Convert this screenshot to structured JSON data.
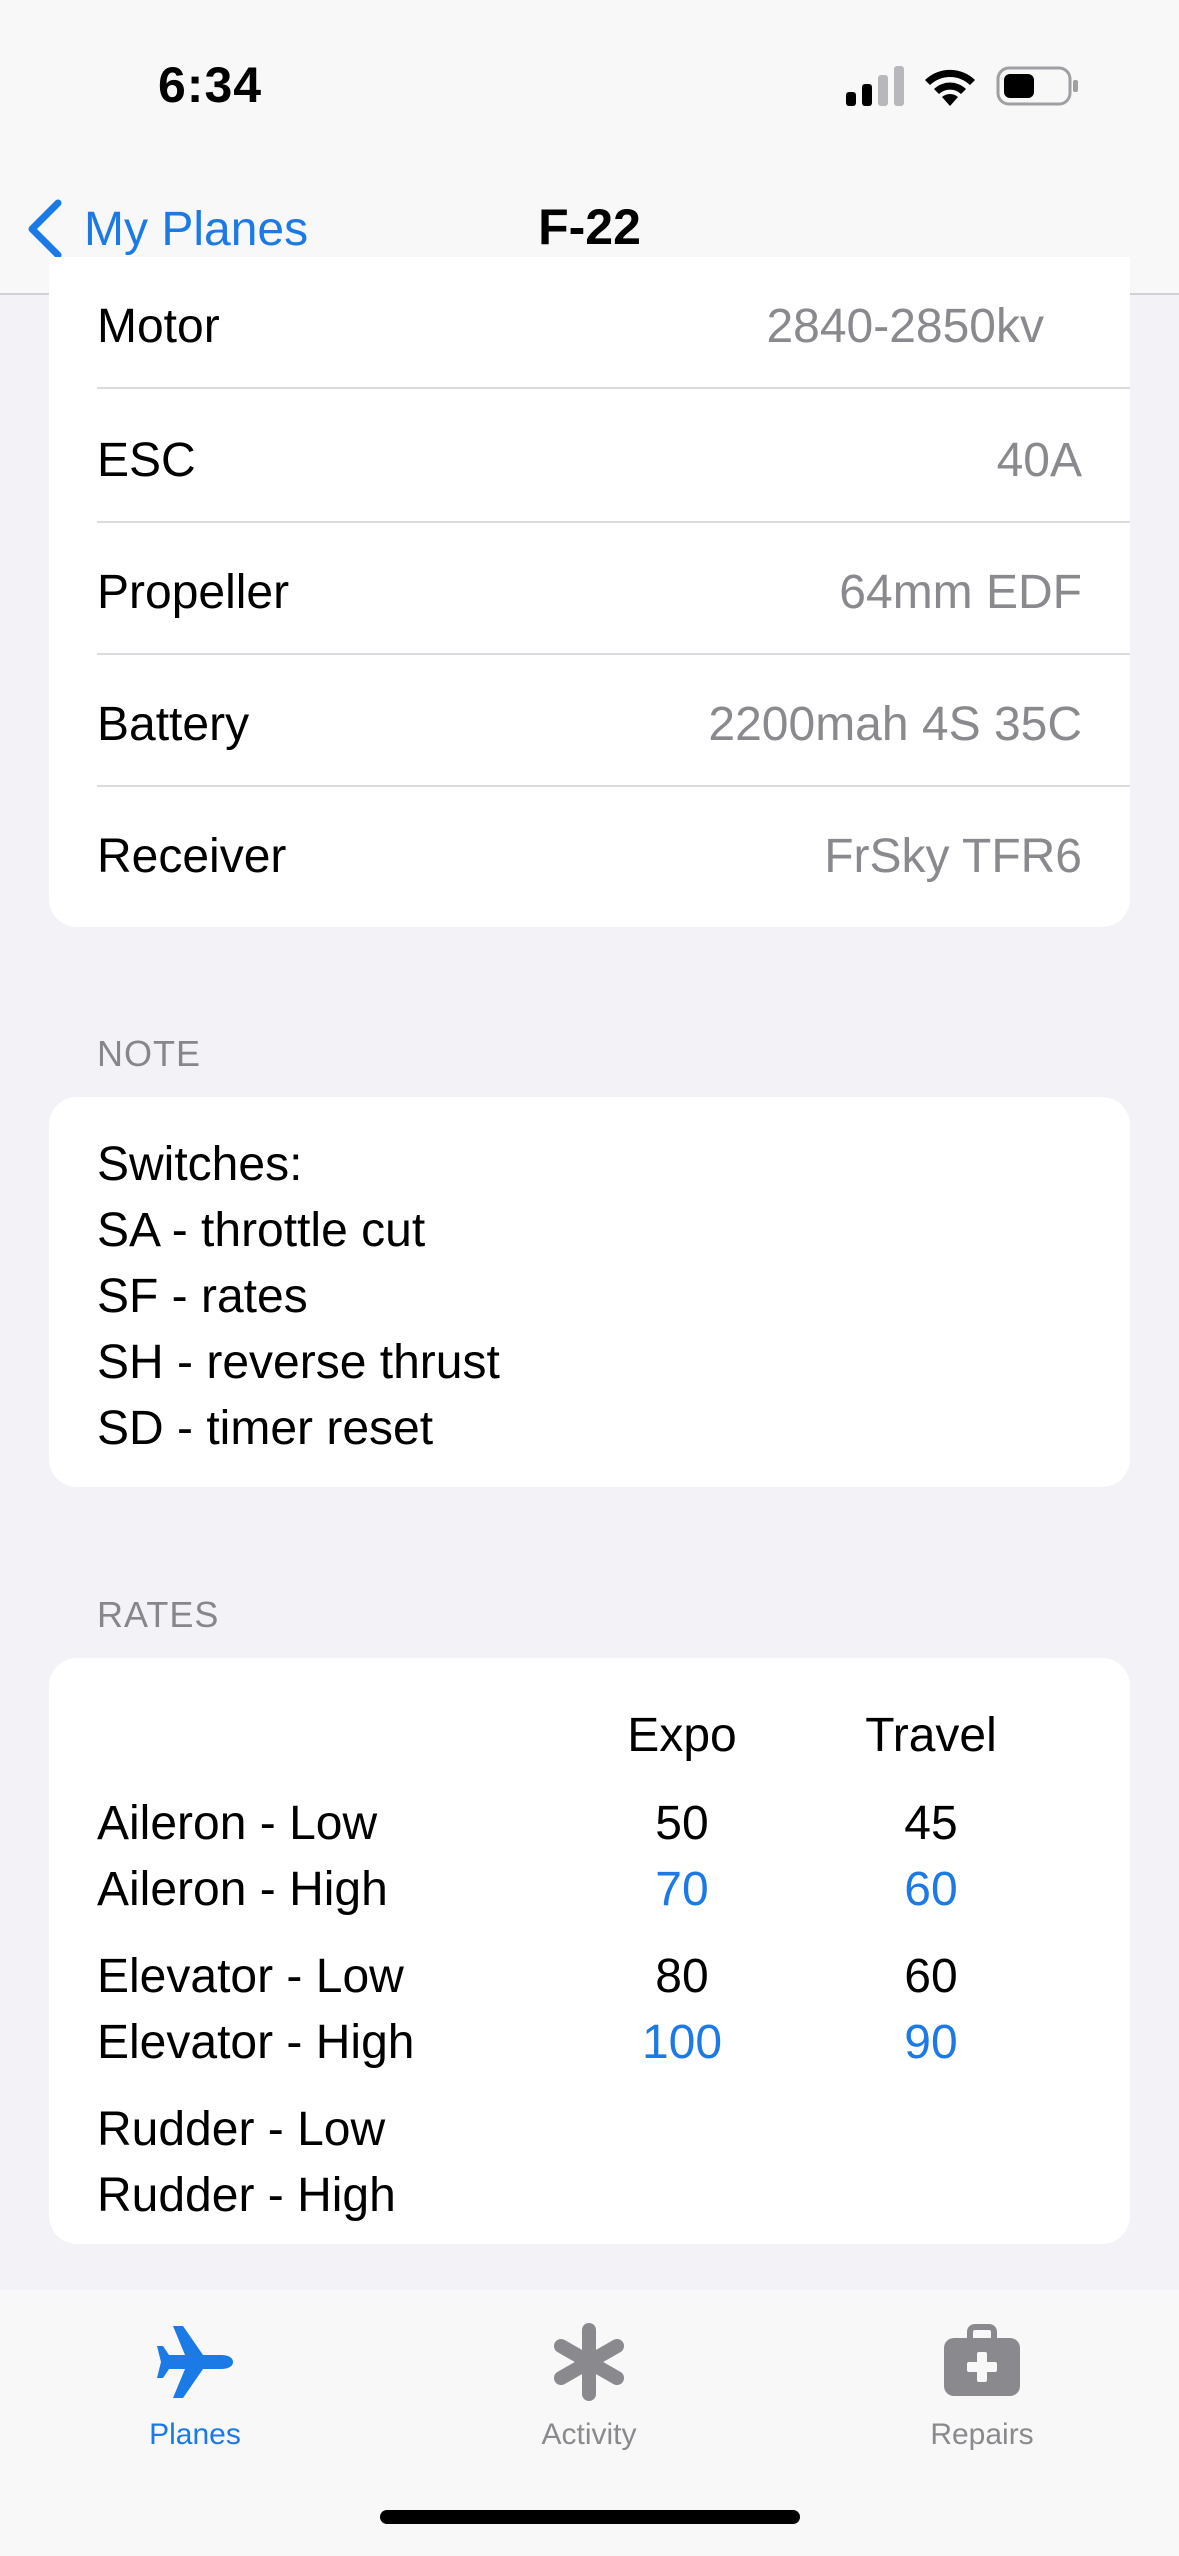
{
  "status_bar": {
    "time": "6:34"
  },
  "nav": {
    "back_label": "My Planes",
    "title": "F-22"
  },
  "specs": [
    {
      "label": "Motor",
      "value": "2840-2850kv"
    },
    {
      "label": "ESC",
      "value": "40A"
    },
    {
      "label": "Propeller",
      "value": "64mm EDF"
    },
    {
      "label": "Battery",
      "value": "2200mah 4S 35C"
    },
    {
      "label": "Receiver",
      "value": "FrSky TFR6"
    }
  ],
  "note": {
    "header": "NOTE",
    "lines": [
      "Switches:",
      "SA - throttle cut",
      "SF - rates",
      "SH - reverse thrust",
      "SD - timer reset"
    ]
  },
  "rates": {
    "header": "RATES",
    "columns": [
      "Expo",
      "Travel"
    ],
    "rows": [
      {
        "label": "Aileron - Low",
        "expo": "50",
        "travel": "45",
        "highlight": false
      },
      {
        "label": "Aileron - High",
        "expo": "70",
        "travel": "60",
        "highlight": true
      },
      {
        "label": "Elevator - Low",
        "expo": "80",
        "travel": "60",
        "highlight": false
      },
      {
        "label": "Elevator - High",
        "expo": "100",
        "travel": "90",
        "highlight": true
      },
      {
        "label": "Rudder - Low",
        "expo": "",
        "travel": "",
        "highlight": false
      },
      {
        "label": "Rudder - High",
        "expo": "",
        "travel": "",
        "highlight": false
      }
    ]
  },
  "tabs": [
    {
      "label": "Planes",
      "icon": "airplane-icon",
      "active": true
    },
    {
      "label": "Activity",
      "icon": "asterisk-icon",
      "active": false
    },
    {
      "label": "Repairs",
      "icon": "first-aid-kit-icon",
      "active": false
    }
  ],
  "colors": {
    "accent": "#1b7ae6",
    "secondary_text": "#8a8a8e",
    "background": "#f2f2f7"
  }
}
